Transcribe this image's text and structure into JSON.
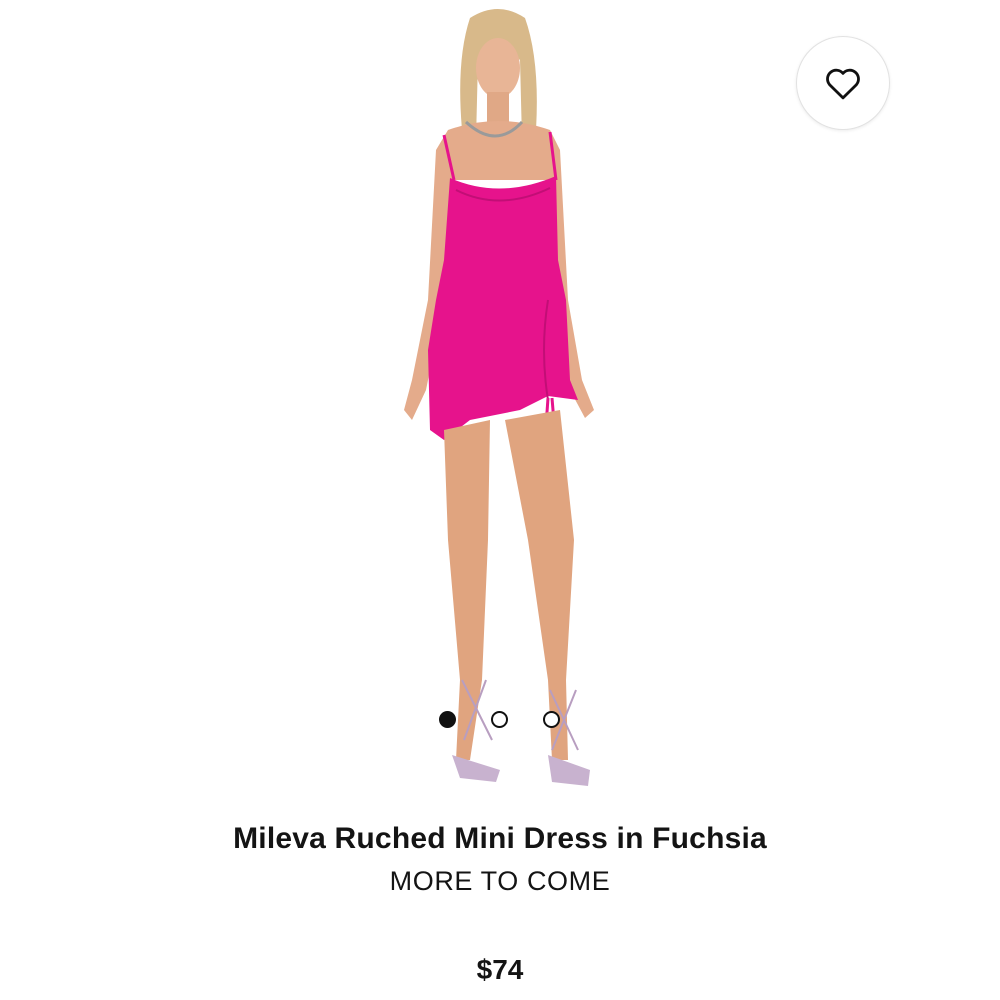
{
  "product": {
    "name": "Mileva Ruched Mini Dress in Fuchsia",
    "subtitle": "MORE TO COME",
    "price": "$74",
    "dress_color": "#E6138C"
  },
  "wishlist": {
    "icon": "heart-outline-icon"
  },
  "carousel": {
    "image_count": 3,
    "active_index": 0
  }
}
